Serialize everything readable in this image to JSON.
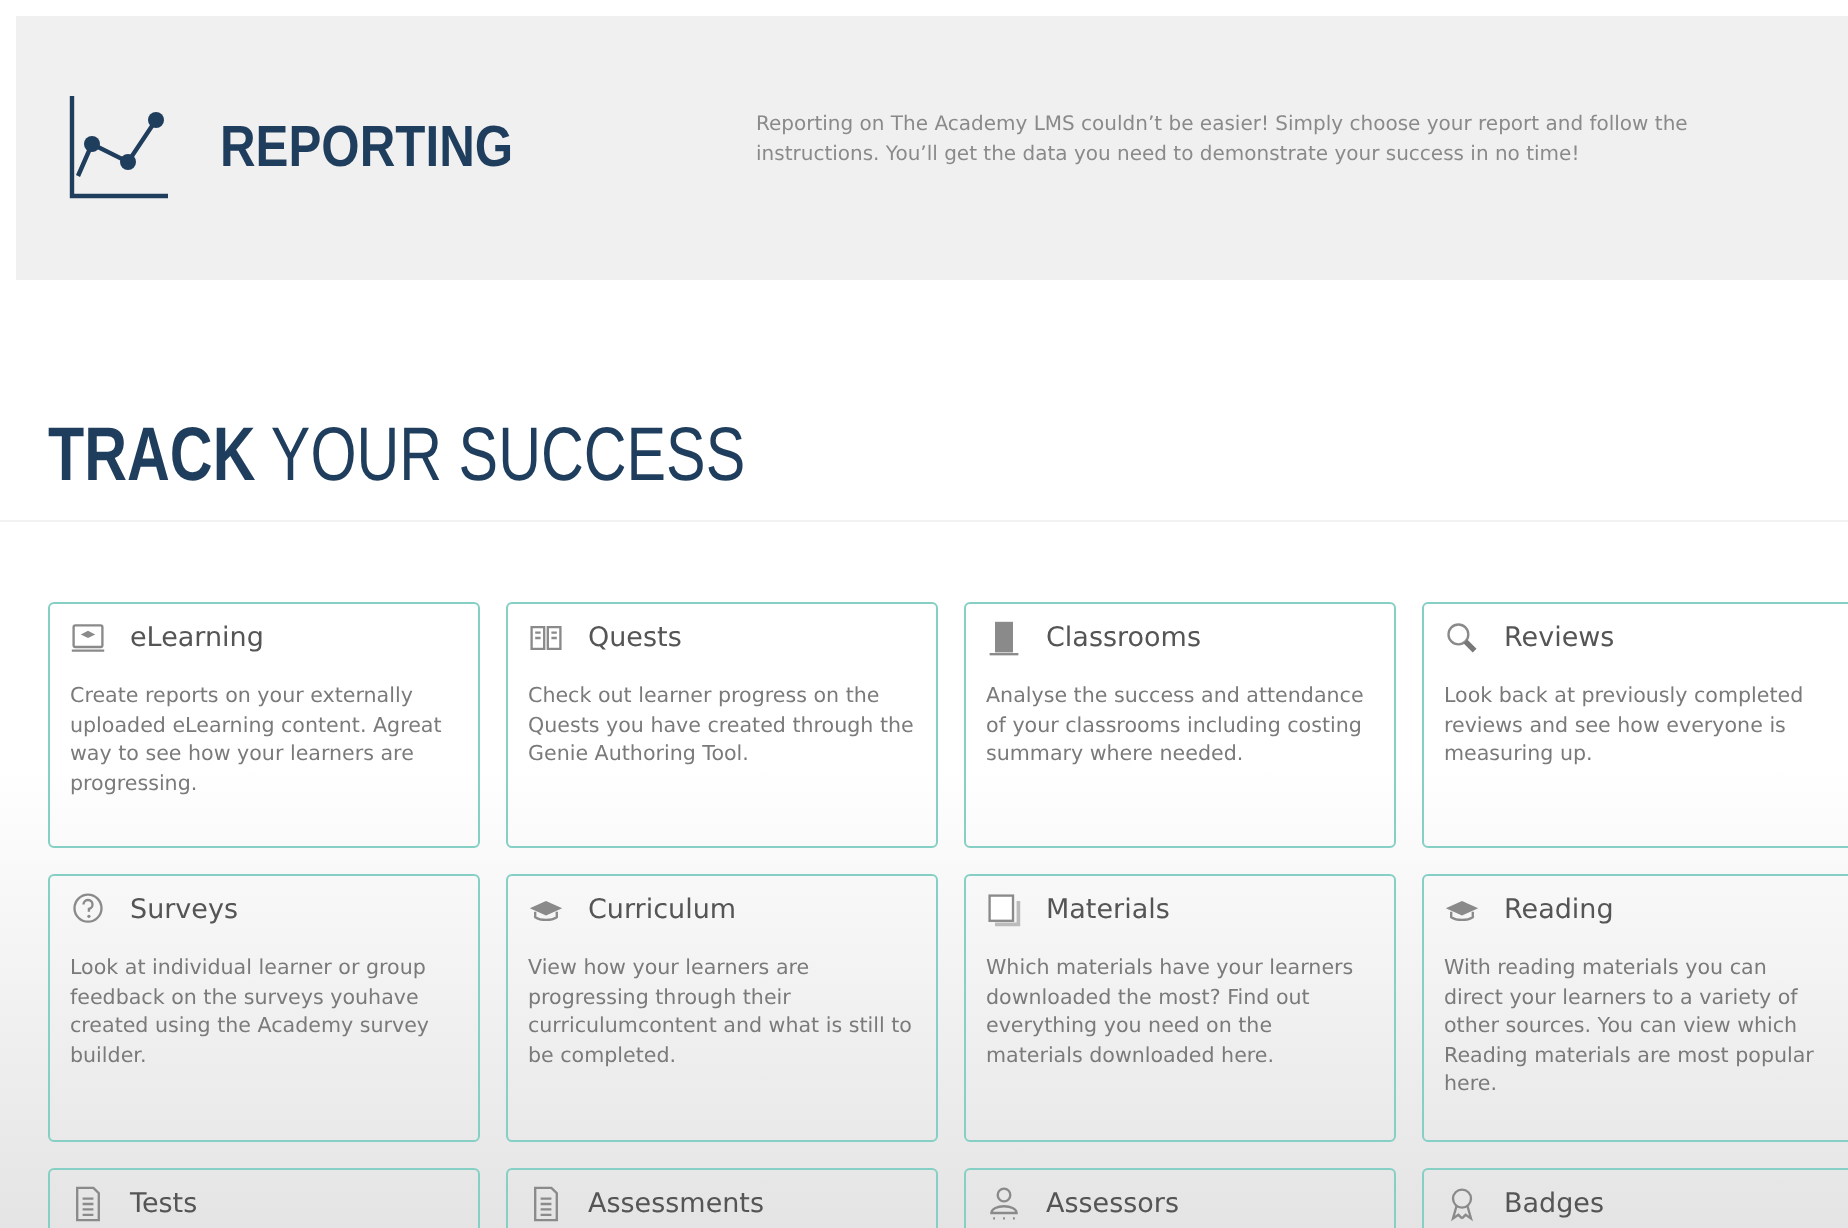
{
  "header": {
    "title": "REPORTING",
    "description": "Reporting on The Academy LMS couldn’t be easier! Simply choose your report and follow the instructions. You’ll get the data you need to demonstrate your success in no time!"
  },
  "heading": "**TRACK** YOUR SUCCESS",
  "cards": [
    {
      "title": "eLearning",
      "description": "Create reports on your externally uploaded eLearning content. Agreat way to see how your learners are progressing."
    },
    {
      "title": "Quests",
      "description": "Check out learner progress on the Quests you have created through the Genie Authoring Tool."
    },
    {
      "title": "Classrooms",
      "description": "Analyse the success and attendance of your classrooms including costing summary where needed."
    },
    {
      "title": "Reviews",
      "description": "Look back at previously completed reviews and see how everyone is measuring up."
    },
    {
      "title": "Surveys",
      "description": "Look at individual learner or group feedback on the surveys youhave created using the Academy survey builder."
    },
    {
      "title": "Curriculum",
      "description": "View how your learners are progressing through their curriculumcontent and what is still to be completed."
    },
    {
      "title": "Materials",
      "description": "Which materials have your learners downloaded the most? Find out everything you need on the materials downloaded here."
    },
    {
      "title": "Reading",
      "description": "With reading materials you can direct your learners to a variety of other sources. You can view which Reading materials are most popular here."
    },
    {
      "title": "Tests"
    },
    {
      "title": "Assessments"
    },
    {
      "title": "Assessors"
    },
    {
      "title": "Badges"
    }
  ]
}
